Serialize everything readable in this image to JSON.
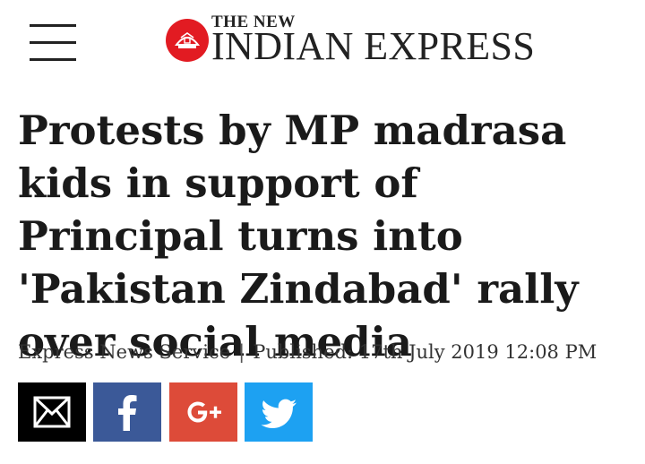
{
  "header": {
    "logo_top": "THE NEW",
    "logo_main": "INDIAN EXPRESS",
    "accent_color": "#e21b22"
  },
  "article": {
    "headline": "Protests by MP madrasa kids in support of Principal turns into 'Pakistan Zindabad' rally over social media",
    "author": "Express News Service",
    "separator": "|",
    "published_label": "Published:",
    "published_date": "17th July 2019 12:08 PM"
  },
  "share": {
    "items": [
      {
        "icon": "email-icon",
        "color": "#000000"
      },
      {
        "icon": "facebook-icon",
        "color": "#3b5998"
      },
      {
        "icon": "google-plus-icon",
        "color": "#dd4b39"
      },
      {
        "icon": "twitter-icon",
        "color": "#1da1f2"
      }
    ]
  }
}
